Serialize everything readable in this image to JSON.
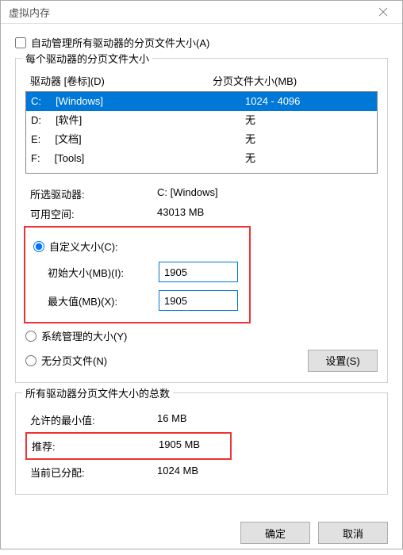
{
  "title": "虚拟内存",
  "auto_manage_label": "自动管理所有驱动器的分页文件大小(A)",
  "group1": {
    "label": "每个驱动器的分页文件大小",
    "col_drive": "驱动器 [卷标](D)",
    "col_size": "分页文件大小(MB)",
    "rows": [
      {
        "drive": "C:",
        "vol": "[Windows]",
        "size": "1024 - 4096"
      },
      {
        "drive": "D:",
        "vol": "[软件]",
        "size": "无"
      },
      {
        "drive": "E:",
        "vol": "[文档]",
        "size": "无"
      },
      {
        "drive": "F:",
        "vol": "[Tools]",
        "size": "无"
      }
    ],
    "selected_label": "所选驱动器:",
    "selected_value": "C:  [Windows]",
    "free_label": "可用空间:",
    "free_value": "43013 MB",
    "custom_label": "自定义大小(C):",
    "initial_label": "初始大小(MB)(I):",
    "initial_value": "1905",
    "max_label": "最大值(MB)(X):",
    "max_value": "1905",
    "system_label": "系统管理的大小(Y)",
    "none_label": "无分页文件(N)",
    "set_button": "设置(S)"
  },
  "group2": {
    "label": "所有驱动器分页文件大小的总数",
    "min_label": "允许的最小值:",
    "min_value": "16 MB",
    "rec_label": "推荐:",
    "rec_value": "1905 MB",
    "cur_label": "当前已分配:",
    "cur_value": "1024 MB"
  },
  "ok_label": "确定",
  "cancel_label": "取消"
}
